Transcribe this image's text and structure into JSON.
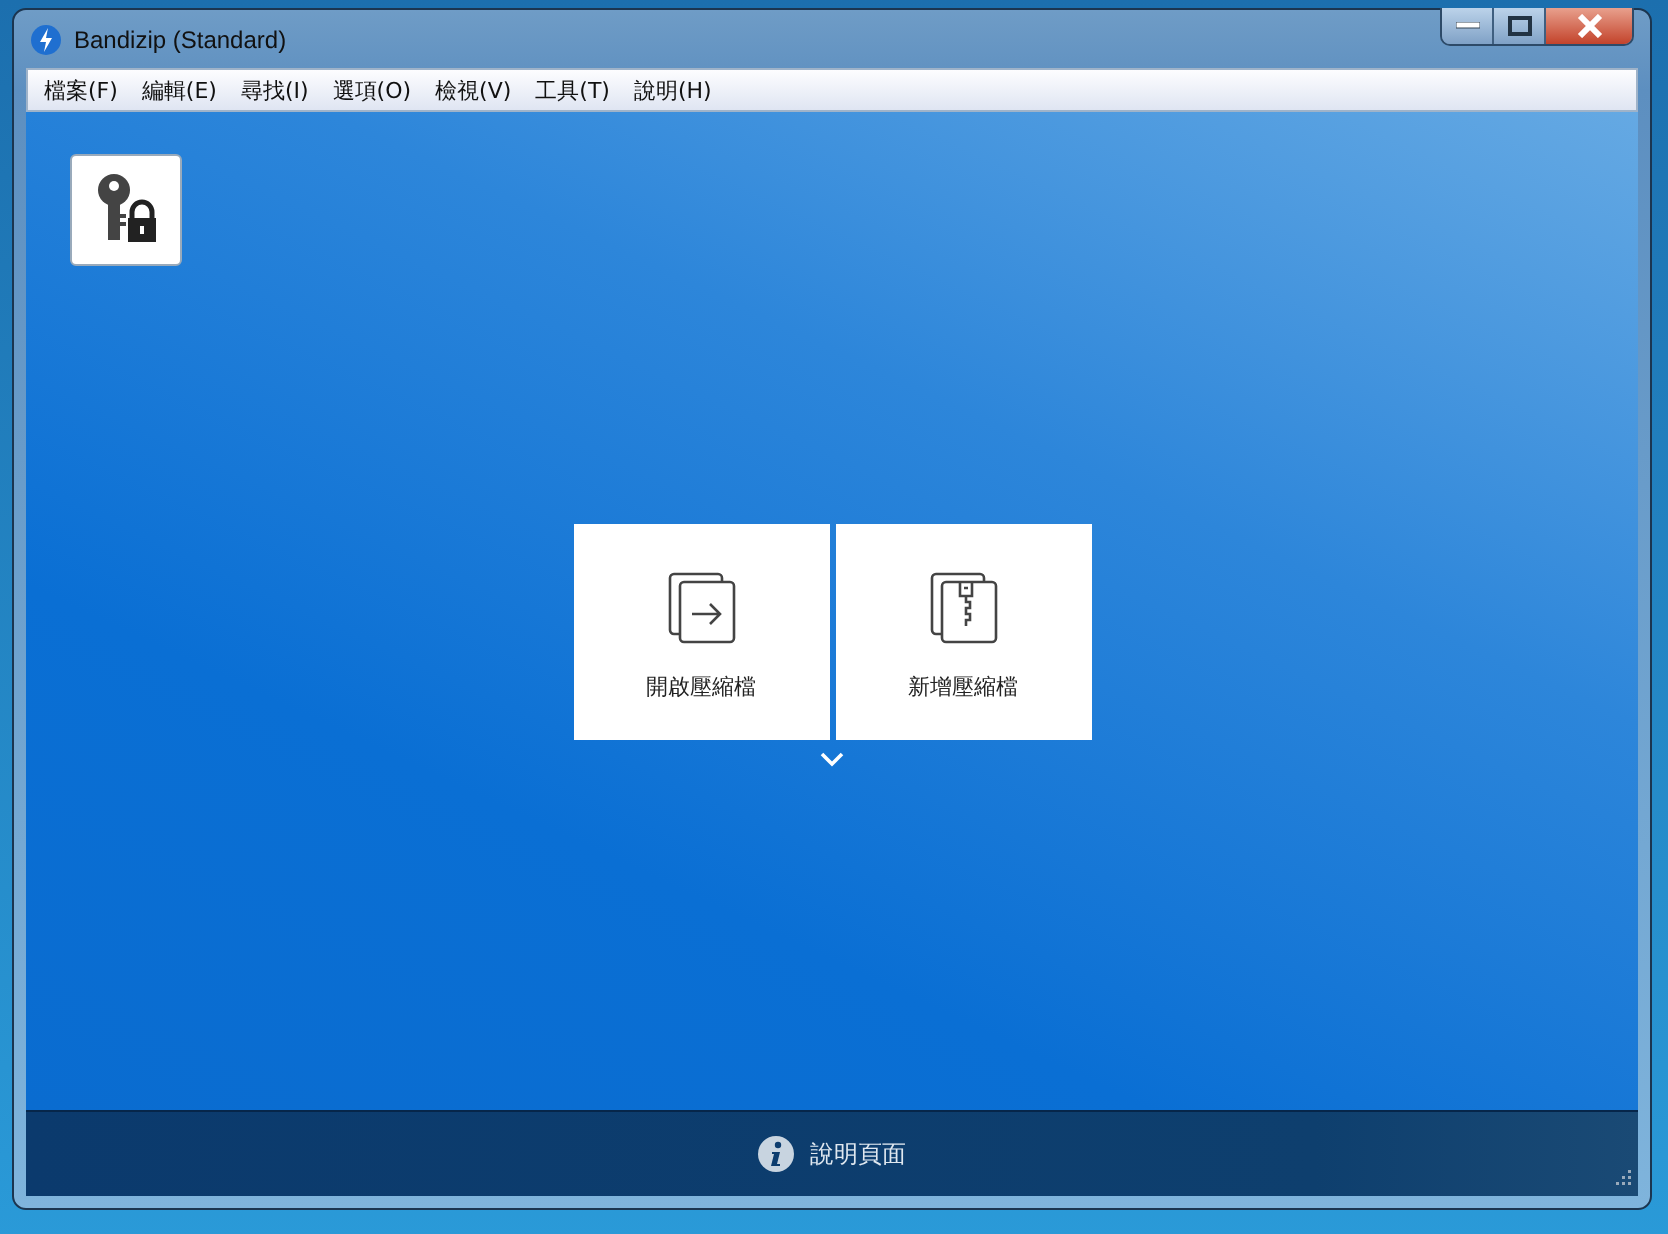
{
  "window": {
    "title": "Bandizip (Standard)"
  },
  "menu": [
    {
      "label": "檔案(F)"
    },
    {
      "label": "編輯(E)"
    },
    {
      "label": "尋找(I)"
    },
    {
      "label": "選項(O)"
    },
    {
      "label": "檢視(V)"
    },
    {
      "label": "工具(T)"
    },
    {
      "label": "說明(H)"
    }
  ],
  "actions": [
    {
      "kind": "open",
      "label": "開啟壓縮檔"
    },
    {
      "kind": "new",
      "label": "新增壓縮檔"
    }
  ],
  "footer": {
    "label": "說明頁面"
  }
}
